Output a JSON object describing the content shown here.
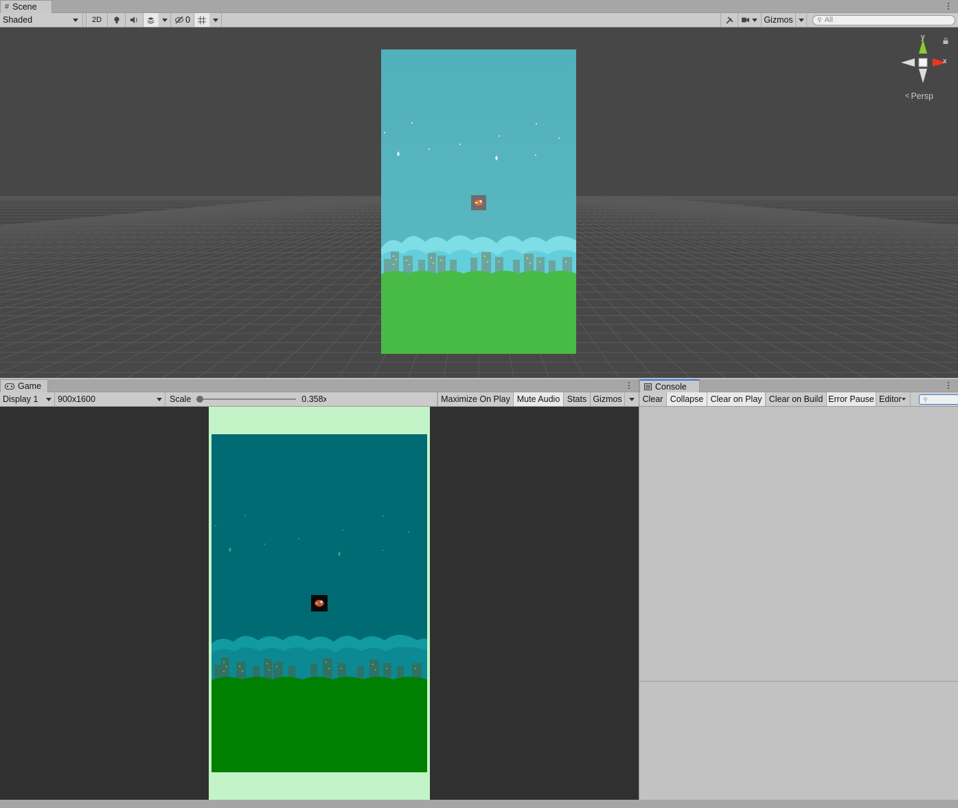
{
  "scene": {
    "tab_label": "Scene",
    "shading_mode": "Shaded",
    "mode_2d_label": "2D",
    "hidden_count": "0",
    "gizmos_label": "Gizmos",
    "search_placeholder": "All",
    "projection_label": "Persp",
    "axis_y": "y",
    "axis_x": "x"
  },
  "game": {
    "tab_label": "Game",
    "display": "Display 1",
    "resolution": "900x1600",
    "scale_label": "Scale",
    "scale_value": "0.358x",
    "scale_fraction": 0.0,
    "maximize_on_play": "Maximize On Play",
    "mute_audio": "Mute Audio",
    "stats": "Stats",
    "gizmos": "Gizmos"
  },
  "console": {
    "tab_label": "Console",
    "clear": "Clear",
    "collapse": "Collapse",
    "clear_on_play": "Clear on Play",
    "clear_on_build": "Clear on Build",
    "error_pause": "Error Pause",
    "editor": "Editor",
    "search_value": ""
  },
  "colors": {
    "scene_sky": "#55b3bd",
    "scene_ground": "#48bb46",
    "game_sky": "#006b73",
    "game_ground": "#008000",
    "letterbox": "#c3f4c8",
    "editor_gray": "#c2c2c2",
    "gizmo_y": "#7ed321",
    "gizmo_x": "#e8361f",
    "tab_accent": "#3a79d7"
  }
}
